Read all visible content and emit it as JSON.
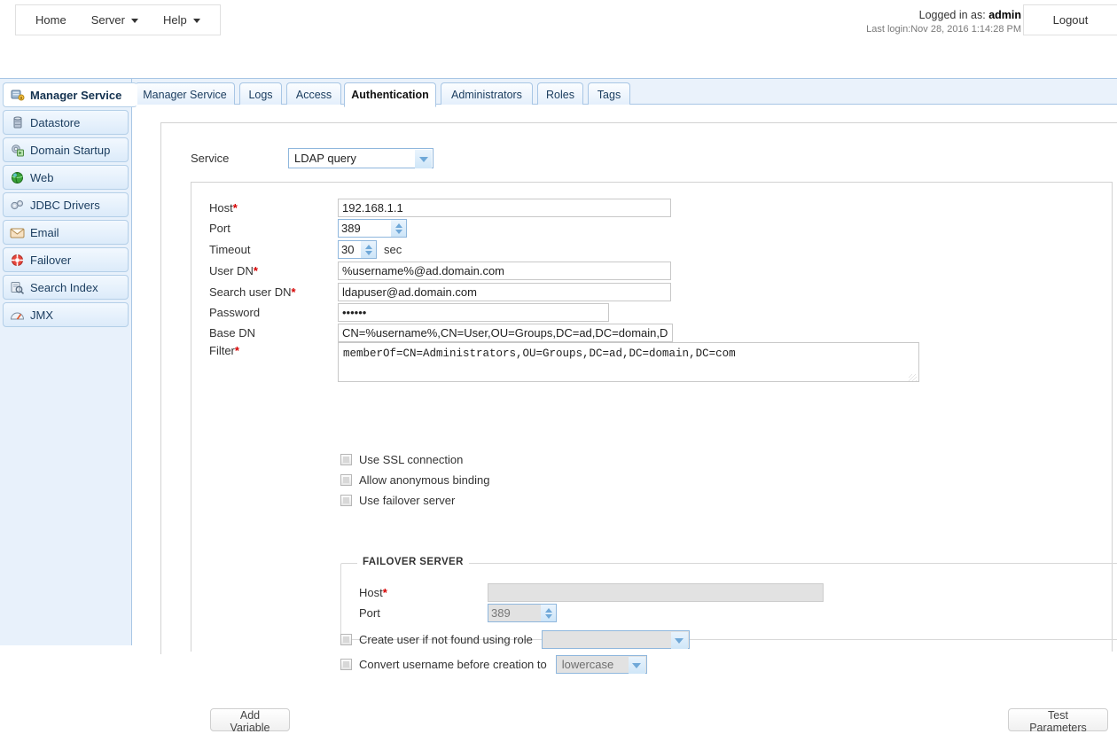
{
  "header": {
    "nav": [
      {
        "label": "Home",
        "has_caret": false
      },
      {
        "label": "Server",
        "has_caret": true
      },
      {
        "label": "Help",
        "has_caret": true
      }
    ],
    "logged_in_prefix": "Logged in as: ",
    "logged_in_user": "admin",
    "last_login": "Last login:Nov 28, 2016 1:14:28 PM",
    "logout_label": "Logout"
  },
  "sidebar": {
    "items": [
      {
        "label": "Manager Service",
        "icon": "manager-service-icon",
        "active": true
      },
      {
        "label": "Datastore",
        "icon": "datastore-icon",
        "active": false
      },
      {
        "label": "Domain Startup",
        "icon": "domain-startup-icon",
        "active": false
      },
      {
        "label": "Web",
        "icon": "web-globe-icon",
        "active": false
      },
      {
        "label": "JDBC Drivers",
        "icon": "jdbc-drivers-icon",
        "active": false
      },
      {
        "label": "Email",
        "icon": "email-icon",
        "active": false
      },
      {
        "label": "Failover",
        "icon": "failover-icon",
        "active": false
      },
      {
        "label": "Search Index",
        "icon": "search-index-icon",
        "active": false
      },
      {
        "label": "JMX",
        "icon": "jmx-icon",
        "active": false
      }
    ]
  },
  "tabs": [
    {
      "label": "Manager Service",
      "active": false
    },
    {
      "label": "Logs",
      "active": false
    },
    {
      "label": "Access",
      "active": false
    },
    {
      "label": "Authentication",
      "active": true
    },
    {
      "label": "Administrators",
      "active": false
    },
    {
      "label": "Roles",
      "active": false
    },
    {
      "label": "Tags",
      "active": false
    }
  ],
  "form": {
    "service_label": "Service",
    "service_value": "LDAP query",
    "fields": {
      "host_label": "Host",
      "host_value": "192.168.1.1",
      "port_label": "Port",
      "port_value": "389",
      "timeout_label": "Timeout",
      "timeout_value": "30",
      "timeout_unit": "sec",
      "user_dn_label": "User DN",
      "user_dn_value": "%username%@ad.domain.com",
      "search_user_dn_label": "Search user DN",
      "search_user_dn_value": "ldapuser@ad.domain.com",
      "password_label": "Password",
      "password_value": "••••••",
      "base_dn_label": "Base DN",
      "base_dn_value": "CN=%username%,CN=User,OU=Groups,DC=ad,DC=domain,DC=com",
      "filter_label": "Filter",
      "filter_value": "memberOf=CN=Administrators,OU=Groups,DC=ad,DC=domain,DC=com"
    },
    "checkboxes": [
      {
        "label": "Use SSL connection",
        "checked": false
      },
      {
        "label": "Allow anonymous binding",
        "checked": false
      },
      {
        "label": "Use failover server",
        "checked": false
      }
    ],
    "failover": {
      "legend": "FAILOVER SERVER",
      "host_label": "Host",
      "host_value": "",
      "port_label": "Port",
      "port_value": "389"
    },
    "create_user_label": "Create user if not found using role",
    "create_user_role_value": "",
    "convert_username_label": "Convert username before creation to",
    "convert_username_value": "lowercase"
  },
  "buttons": {
    "add_variable": "Add Variable",
    "test_parameters": "Test Parameters"
  },
  "colors": {
    "required_asterisk": "#d60000",
    "sidebar_bg": "#e8f1fb",
    "tab_border": "#a8c6e5",
    "accent_blue": "#6fa8d8"
  }
}
